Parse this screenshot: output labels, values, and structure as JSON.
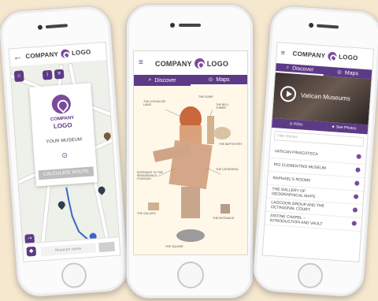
{
  "brand": {
    "company": "COMPANY",
    "logo_word": "LOGO",
    "accent": "#5d3a86"
  },
  "phone1": {
    "card_company": "COMPANY",
    "card_logo": "LOGO",
    "museum_label": "YOUR MUSEUM",
    "calculate_button": "CALCULATE ROUTE",
    "bottom_placeholder": "Museum name"
  },
  "phone2": {
    "tabs": [
      "Discover",
      "Maps"
    ],
    "labels": [
      "THE LOGGIA DEI LANZI",
      "THE DOME",
      "THE BELL TOWER",
      "THE BAPTISTERY",
      "ENTRANCE TO THE RENAISSANCE FOUNTAIN",
      "THE CATHEDRAL",
      "THE GALLERY",
      "THE ENTRANCE",
      "THE SQUARE"
    ]
  },
  "phone3": {
    "tabs": [
      "Discover",
      "Maps"
    ],
    "hero_title": "Vatican Museums",
    "hero_actions": [
      "POIs",
      "See Photos"
    ],
    "search_placeholder": "Filter Rooms",
    "items": [
      "VATICAN PINACOTECA",
      "PIO CLEMENTINO MUSEUM",
      "RAPHAEL'S ROOMS",
      "THE GALLERY OF GEOGRAPHICAL MAPS",
      "LAOCOON GROUP AND THE OCTAGONAL COURT",
      "SISTINE CHAPEL – INTRODUCTION AND VAULT"
    ]
  }
}
